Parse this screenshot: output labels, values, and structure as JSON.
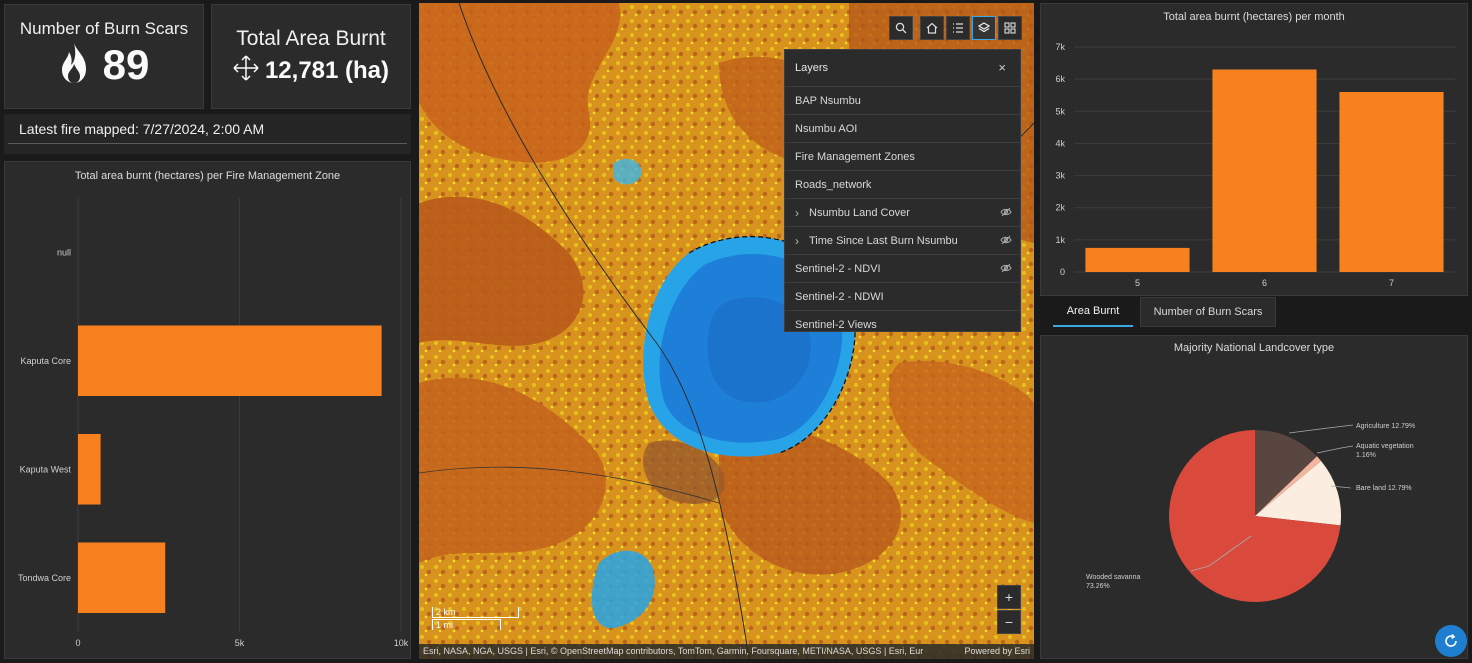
{
  "kpis": {
    "burn_scars": {
      "title": "Number of Burn Scars",
      "value": "89",
      "icon": "flame-icon"
    },
    "area": {
      "title": "Total Area Burnt",
      "value": "12,781 (ha)",
      "icon": "move-arrows-icon"
    }
  },
  "latest_fire": "Latest fire mapped: 7/27/2024, 2:00 AM",
  "zone_chart": {
    "title": "Total area burnt (hectares) per Fire Management Zone",
    "categories": [
      "null",
      "Kaputa Core",
      "Kaputa West",
      "Tondwa Core"
    ],
    "tick_labels": [
      "0",
      "5k",
      "10k"
    ],
    "bar_color": "#f7801f"
  },
  "month_chart": {
    "title": "Total area burnt (hectares) per month",
    "categories": [
      "5",
      "6",
      "7"
    ],
    "tick_labels": [
      "0",
      "1k",
      "2k",
      "3k",
      "4k",
      "5k",
      "6k",
      "7k"
    ],
    "bar_color": "#f7801f"
  },
  "tabs": [
    {
      "label": "Area Burnt",
      "active": true
    },
    {
      "label": "Number of Burn Scars",
      "active": false
    }
  ],
  "pie_chart": {
    "title": "Majority National Landcover type",
    "labels": {
      "agriculture": "Agriculture 12.79%",
      "aquatic1": "Aquatic vegetation",
      "aquatic2": "1.16%",
      "bare": "Bare land 12.79%",
      "wooded1": "Wooded savanna",
      "wooded2": "73.26%"
    }
  },
  "chart_data": [
    {
      "type": "bar",
      "orientation": "horizontal",
      "title": "Total area burnt (hectares) per Fire Management Zone",
      "categories": [
        "null",
        "Kaputa Core",
        "Kaputa West",
        "Tondwa Core"
      ],
      "values": [
        0,
        9400,
        700,
        2700
      ],
      "xlim": [
        0,
        10000
      ],
      "grid": true
    },
    {
      "type": "bar",
      "title": "Total area burnt (hectares) per month",
      "categories": [
        "5",
        "6",
        "7"
      ],
      "values": [
        750,
        6300,
        5600
      ],
      "ylim": [
        0,
        7000
      ],
      "grid": true
    },
    {
      "type": "pie",
      "title": "Majority National Landcover type",
      "slices": [
        {
          "name": "Agriculture",
          "value": 12.79,
          "color": "#5a4640"
        },
        {
          "name": "Aquatic vegetation",
          "value": 1.16,
          "color": "#f2b59d"
        },
        {
          "name": "Bare land",
          "value": 12.79,
          "color": "#fbeee0"
        },
        {
          "name": "Wooded savanna",
          "value": 73.26,
          "color": "#d94a3d"
        }
      ]
    }
  ],
  "map": {
    "layers_title": "Layers",
    "layers": [
      {
        "label": "BAP Nsumbu",
        "expandable": false,
        "hidden": false
      },
      {
        "label": "Nsumbu AOI",
        "expandable": false,
        "hidden": false
      },
      {
        "label": "Fire Management Zones",
        "expandable": false,
        "hidden": false
      },
      {
        "label": "Roads_network",
        "expandable": false,
        "hidden": false
      },
      {
        "label": "Nsumbu Land Cover",
        "expandable": true,
        "hidden": true
      },
      {
        "label": "Time Since Last Burn Nsumbu",
        "expandable": true,
        "hidden": true
      },
      {
        "label": "Sentinel-2 - NDVI",
        "expandable": false,
        "hidden": true
      },
      {
        "label": "Sentinel-2 - NDWI",
        "expandable": false,
        "hidden": false
      },
      {
        "label": "Sentinel-2 Views",
        "expandable": false,
        "hidden": false
      }
    ],
    "scale_km": "2 km",
    "scale_mi": "1 mi",
    "attribution": "Esri, NASA, NGA, USGS | Esri, © OpenStreetMap contributors, TomTom, Garmin, Foursquare, METI/NASA, USGS | Esri, Eur",
    "powered_by": "Powered by Esri",
    "zoom_in": "+",
    "zoom_out": "−"
  }
}
